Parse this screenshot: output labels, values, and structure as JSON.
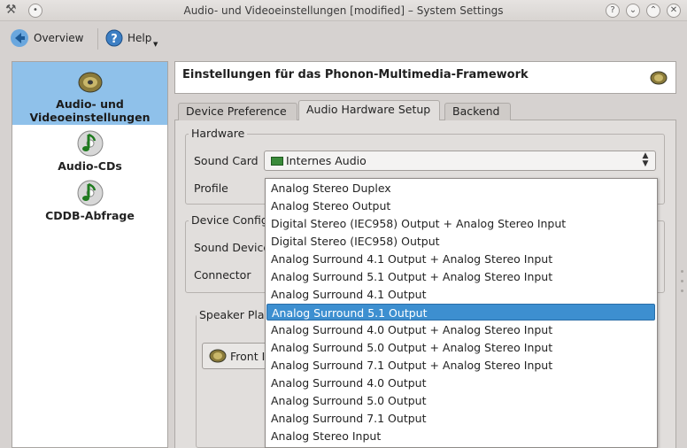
{
  "window": {
    "title": "Audio- und Videoeinstellungen [modified] – System Settings"
  },
  "toolbar": {
    "overview_label": "Overview",
    "help_label": "Help"
  },
  "sidebar": {
    "items": [
      {
        "label_line1": "Audio- und",
        "label_line2": "Videoeinstellungen",
        "icon": "speaker-icon"
      },
      {
        "label": "Audio-CDs",
        "icon": "music-cd-icon"
      },
      {
        "label": "CDDB-Abfrage",
        "icon": "music-cd-icon"
      }
    ]
  },
  "header": {
    "title": "Einstellungen für das Phonon-Multimedia-Framework"
  },
  "tabs": [
    {
      "label": "Device Preference"
    },
    {
      "label": "Audio Hardware Setup"
    },
    {
      "label": "Backend"
    }
  ],
  "hardware": {
    "group_title": "Hardware",
    "sound_card_label": "Sound Card",
    "sound_card_value": "Internes Audio",
    "profile_label": "Profile"
  },
  "device_config": {
    "group_title": "Device Configu",
    "sound_device_label": "Sound Device",
    "connector_label": "Connector"
  },
  "speaker": {
    "group_title": "Speaker Pla",
    "front_button_label": "Front I"
  },
  "profile_options": [
    "Analog Stereo Duplex",
    "Analog Stereo Output",
    "Digital Stereo (IEC958) Output + Analog Stereo Input",
    "Digital Stereo (IEC958) Output",
    "Analog Surround 4.1 Output + Analog Stereo Input",
    "Analog Surround 5.1 Output + Analog Stereo Input",
    "Analog Surround 4.1 Output",
    "Analog Surround 5.1 Output",
    "Analog Surround 4.0 Output + Analog Stereo Input",
    "Analog Surround 5.0 Output + Analog Stereo Input",
    "Analog Surround 7.1 Output + Analog Stereo Input",
    "Analog Surround 4.0 Output",
    "Analog Surround 5.0 Output",
    "Analog Surround 7.1 Output",
    "Analog Stereo Input"
  ],
  "highlighted_option": "Analog Surround 5.1 Output",
  "colors": {
    "selection": "#8fc1ea",
    "highlight": "#3d8fd0"
  }
}
